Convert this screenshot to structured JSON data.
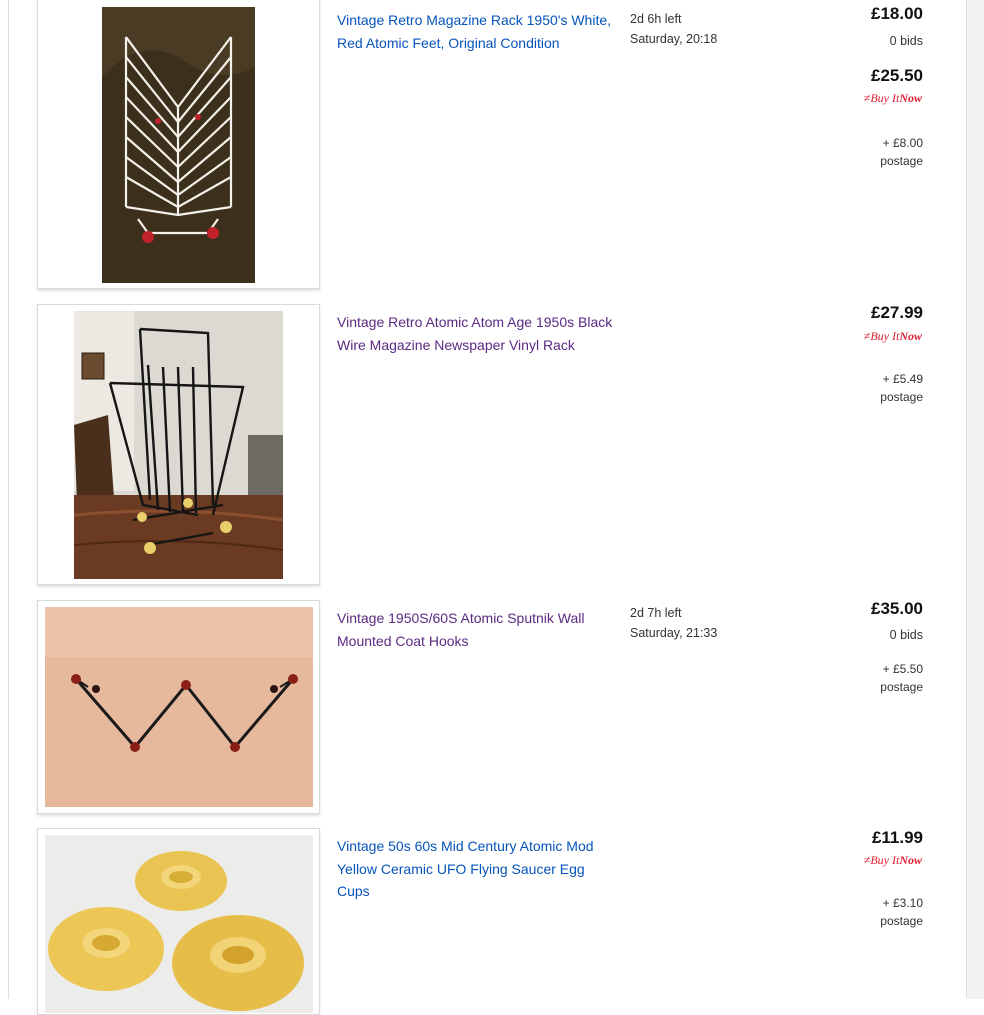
{
  "listings": [
    {
      "title": "Vintage Retro Magazine Rack 1950's White, Red Atomic Feet, Original Condition",
      "time_left": "2d 6h left",
      "end_time": "Saturday, 20:18",
      "price_current": "£18.00",
      "bids": "0 bids",
      "price_buy": "£25.50",
      "buy_it_now": {
        "buy": "Buy It",
        "now": "Now"
      },
      "postage_amount": "+ £8.00",
      "postage_label": "postage"
    },
    {
      "title": "Vintage Retro Atomic Atom Age 1950s Black Wire Magazine Newspaper Vinyl Rack",
      "price": "£27.99",
      "buy_it_now": {
        "buy": "Buy It",
        "now": "Now"
      },
      "postage_amount": "+ £5.49",
      "postage_label": "postage"
    },
    {
      "title": "Vintage 1950S/60S Atomic Sputnik Wall Mounted Coat Hooks",
      "time_left": "2d 7h left",
      "end_time": "Saturday, 21:33",
      "price": "£35.00",
      "bids": "0 bids",
      "postage_amount": "+ £5.50",
      "postage_label": "postage"
    },
    {
      "title": "Vintage 50s 60s Mid Century Atomic Mod Yellow Ceramic UFO Flying Saucer Egg Cups",
      "price": "£11.99",
      "buy_it_now": {
        "buy": "Buy It",
        "now": "Now"
      },
      "postage_amount": "+ £3.10",
      "postage_label": "postage"
    }
  ],
  "colors": {
    "link": "#0654ba",
    "visited_link": "#5b2a83",
    "buy_it_now_red": "#dd1e31",
    "price_text": "#111111"
  },
  "icons": [
    "buy-it-now-logo"
  ]
}
